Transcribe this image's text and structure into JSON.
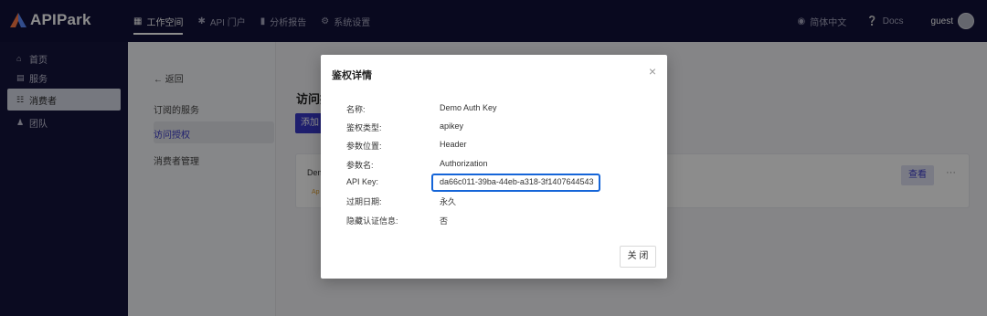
{
  "app": {
    "brand": "APIPark"
  },
  "topnav": {
    "items": [
      {
        "label": "工作空间",
        "icon": "grid-icon",
        "active": true
      },
      {
        "label": "API 门户",
        "icon": "sparkle-icon",
        "active": false
      },
      {
        "label": "分析报告",
        "icon": "bar-chart-icon",
        "active": false
      },
      {
        "label": "系统设置",
        "icon": "gear-icon",
        "active": false
      }
    ],
    "language": "简体中文",
    "docs": "Docs",
    "user": "guest"
  },
  "sidebar": {
    "items": [
      {
        "label": "首页",
        "icon": "home-icon"
      },
      {
        "label": "服务",
        "icon": "server-icon"
      },
      {
        "label": "消费者",
        "icon": "apps-icon",
        "active": true
      },
      {
        "label": "团队",
        "icon": "team-icon"
      }
    ]
  },
  "subnav": {
    "back": "← 返回",
    "items": [
      "订阅的服务",
      "访问授权",
      "消费者管理"
    ],
    "active_index": 1
  },
  "content": {
    "title": "访问授权",
    "add_label": "添加",
    "card_name": "Demo Auth Key",
    "card_tag": "Ap",
    "view_label": "查看",
    "more_label": "···"
  },
  "modal": {
    "title": "鉴权详情",
    "close_icon": "×",
    "rows": [
      {
        "label": "名称:",
        "value": "Demo Auth Key"
      },
      {
        "label": "鉴权类型:",
        "value": "apikey"
      },
      {
        "label": "参数位置:",
        "value": "Header"
      },
      {
        "label": "参数名:",
        "value": "Authorization"
      },
      {
        "label": "API Key:",
        "value": "da66c011-39ba-44eb-a318-3f1407644543"
      },
      {
        "label": "过期日期:",
        "value": "永久"
      },
      {
        "label": "隐藏认证信息:",
        "value": "否"
      }
    ],
    "close_button": "关 闭"
  },
  "colors": {
    "accent": "#3a3ac8",
    "highlight": "#1565d8",
    "nav_bg": "#12123a"
  }
}
